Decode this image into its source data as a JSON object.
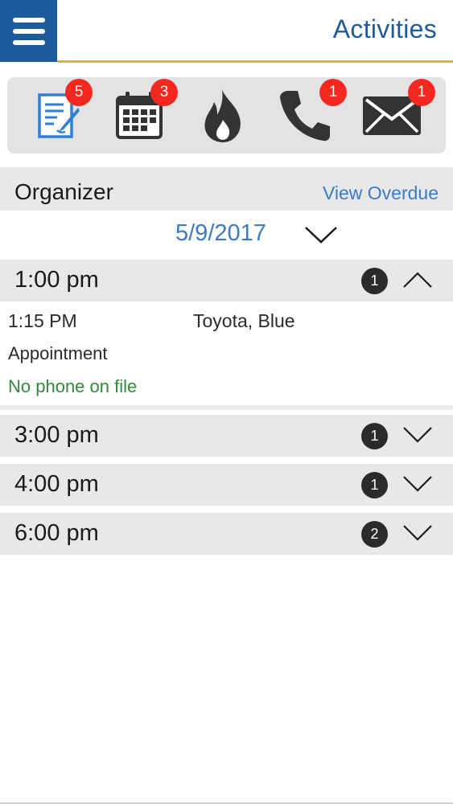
{
  "header": {
    "title": "Activities",
    "accent_color": "#1d5b9c",
    "underline_color": "#f2a93a"
  },
  "icon_bar": {
    "items": [
      {
        "icon": "notes-icon",
        "badge": "5"
      },
      {
        "icon": "calendar-icon",
        "badge": "3"
      },
      {
        "icon": "flame-icon",
        "badge": ""
      },
      {
        "icon": "phone-icon",
        "badge": "1"
      },
      {
        "icon": "mail-icon",
        "badge": "1"
      }
    ],
    "badge_color": "#f4281f"
  },
  "organizer": {
    "label": "Organizer",
    "view_overdue": "View Overdue"
  },
  "date": {
    "value": "5/9/2017"
  },
  "time_groups": [
    {
      "time": "1:00 pm",
      "count": "1",
      "expanded": true
    },
    {
      "time": "3:00 pm",
      "count": "1",
      "expanded": false
    },
    {
      "time": "4:00 pm",
      "count": "1",
      "expanded": false
    },
    {
      "time": "6:00 pm",
      "count": "2",
      "expanded": false
    }
  ],
  "appointment": {
    "time": "1:15 PM",
    "vehicle": "Toyota, Blue",
    "type": "Appointment",
    "phone_status": "No phone on file",
    "phone_status_color": "#2e8b3a"
  }
}
